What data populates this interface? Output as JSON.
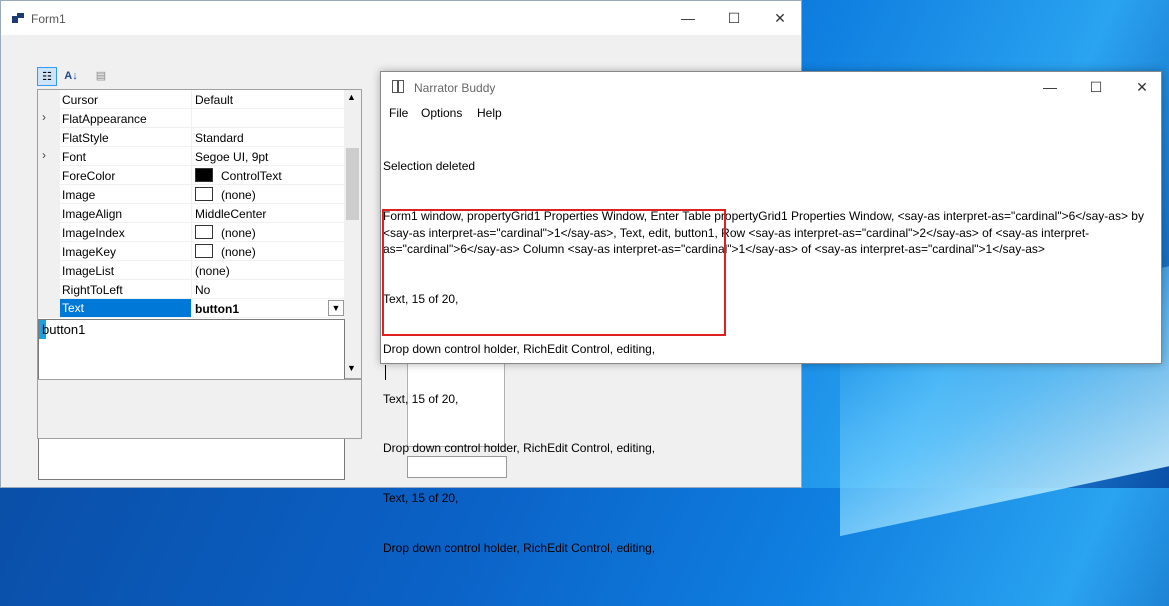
{
  "form1": {
    "title": "Form1",
    "caption_buttons": {
      "minimize": "—",
      "maximize": "☐",
      "close": "✕"
    },
    "toolbar": {
      "categorized": "☷",
      "alphabetical": "A↓",
      "property_pages": "▤"
    },
    "property_grid": {
      "rows": [
        {
          "name": "Cursor",
          "value": "Default",
          "expandable": false
        },
        {
          "name": "FlatAppearance",
          "value": "",
          "expandable": true
        },
        {
          "name": "FlatStyle",
          "value": "Standard",
          "expandable": false
        },
        {
          "name": "Font",
          "value": "Segoe UI, 9pt",
          "expandable": true
        },
        {
          "name": "ForeColor",
          "value": "ControlText",
          "swatch": "#000000",
          "expandable": false
        },
        {
          "name": "Image",
          "value": "(none)",
          "swatch": "#ffffff",
          "expandable": false
        },
        {
          "name": "ImageAlign",
          "value": "MiddleCenter",
          "expandable": false
        },
        {
          "name": "ImageIndex",
          "value": "(none)",
          "swatch": "#ffffff",
          "expandable": false
        },
        {
          "name": "ImageKey",
          "value": "(none)",
          "swatch": "#ffffff",
          "expandable": false
        },
        {
          "name": "ImageList",
          "value": "(none)",
          "expandable": false
        },
        {
          "name": "RightToLeft",
          "value": "No",
          "expandable": false
        },
        {
          "name": "Text",
          "value": "button1",
          "selected": true,
          "expandable": false
        }
      ],
      "dropdown_text": "button1"
    }
  },
  "narrator_buddy": {
    "title": "Narrator Buddy",
    "caption_buttons": {
      "minimize": "—",
      "maximize": "☐",
      "close": "✕"
    },
    "menu": [
      "File",
      "Options",
      "Help"
    ],
    "log": [
      "Selection deleted",
      "Form1 window, propertyGrid1 Properties Window, Enter Table propertyGrid1 Properties Window, <say-as interpret-as=\"cardinal\">6</say-as> by <say-as interpret-as=\"cardinal\">1</say-as>, Text, edit, button1, Row <say-as interpret-as=\"cardinal\">2</say-as> of <say-as interpret-as=\"cardinal\">6</say-as> Column <say-as interpret-as=\"cardinal\">1</say-as> of <say-as interpret-as=\"cardinal\">1</say-as>",
      "Text, 15 of 20,",
      "Drop down control holder, RichEdit Control, editing,",
      "Text, 15 of 20,",
      "Drop down control holder, RichEdit Control, editing,",
      "Text, 15 of 20,",
      "Drop down control holder, RichEdit Control, editing,"
    ],
    "highlight_color": "#e02020"
  },
  "colors": {
    "selection": "#0078d7",
    "caret": "#1ba1e2"
  }
}
